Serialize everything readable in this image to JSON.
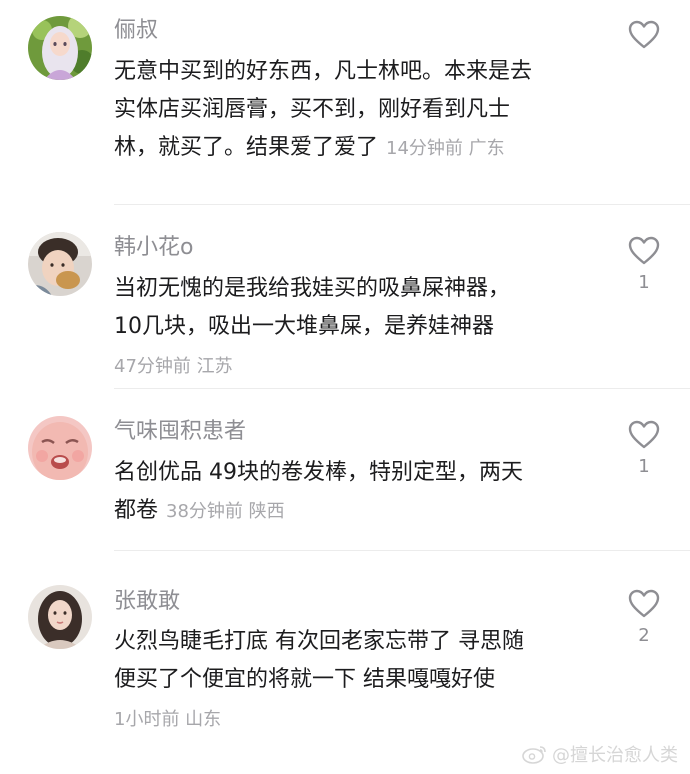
{
  "comments": [
    {
      "username": "俪叔",
      "lines": [
        "无意中买到的好东西，凡士林吧。本来是去",
        "实体店买润唇膏，买不到，刚好看到凡士",
        "林，就买了。结果爱了爱了"
      ],
      "meta": "14分钟前 广东",
      "likes": "",
      "avatar_icon": "girl-avatar-icon"
    },
    {
      "username": "韩小花o",
      "lines": [
        "当初无愧的是我给我娃买的吸鼻屎神器，",
        "10几块，吸出一大堆鼻屎，是养娃神器"
      ],
      "meta": "47分钟前 江苏",
      "likes": "1",
      "avatar_icon": "baby-avatar-icon"
    },
    {
      "username": "气味囤积患者",
      "lines": [
        "名创优品 49块的卷发棒，特别定型，两天",
        "都卷"
      ],
      "meta": "38分钟前 陕西",
      "likes": "1",
      "avatar_icon": "crying-face-avatar-icon"
    },
    {
      "username": "张敢敢",
      "lines": [
        "火烈鸟睫毛打底 有次回老家忘带了 寻思随",
        "便买了个便宜的将就一下 结果嘎嘎好使"
      ],
      "meta": "1小时前 山东",
      "likes": "2",
      "avatar_icon": "woman-avatar-icon"
    }
  ],
  "watermark": "@擅长治愈人类",
  "colors": {
    "username": "#8e8e93",
    "text": "#1c1c1e",
    "meta": "#a7a7ab",
    "divider": "#ececec"
  }
}
